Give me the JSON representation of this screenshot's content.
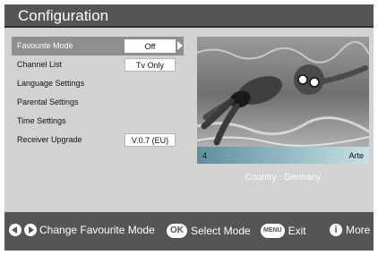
{
  "title": "Configuration",
  "menu": {
    "items": [
      {
        "label": "Favourite Mode",
        "value": "Off"
      },
      {
        "label": "Channel List",
        "value": "Tv Only"
      },
      {
        "label": "Language Settings"
      },
      {
        "label": "Parental Settings"
      },
      {
        "label": "Time Settings"
      },
      {
        "label": "Receiver Upgrade",
        "value": "V.0.7 (EU)"
      }
    ],
    "selected_index": 0
  },
  "channel": {
    "number": "4",
    "name": "Arte"
  },
  "country_text": "Country : Germany",
  "footer": {
    "ok_key": "OK",
    "menu_key": "MENU",
    "change_label": "Change Favourite Mode",
    "select_label": "Select Mode",
    "exit_label": "Exit",
    "more_label": "More"
  },
  "colors": {
    "titlebar": "#555555",
    "panel": "#d2d2d2",
    "selected_row": "#8f8f8f"
  }
}
